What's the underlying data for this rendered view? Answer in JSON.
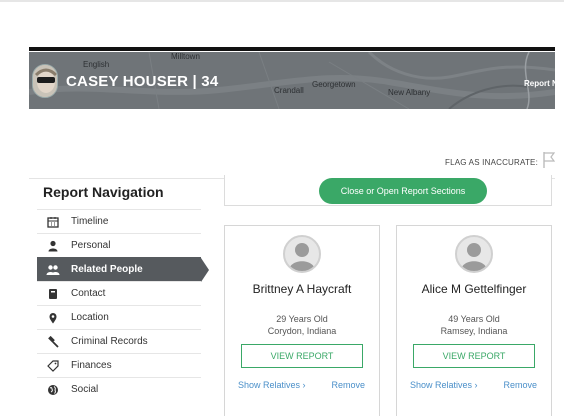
{
  "header": {
    "name": "CASEY HOUSER | 34",
    "report_nav_label": "Report N",
    "map_labels": [
      "Milltown",
      "English",
      "Crandall",
      "Georgetown",
      "New Albany"
    ]
  },
  "flag": {
    "label": "FLAG AS INACCURATE:"
  },
  "nav": {
    "title": "Report Navigation",
    "items": [
      {
        "label": "Timeline",
        "icon": "calendar-icon"
      },
      {
        "label": "Personal",
        "icon": "person-icon"
      },
      {
        "label": "Related People",
        "icon": "people-icon",
        "active": true
      },
      {
        "label": "Contact",
        "icon": "address-book-icon"
      },
      {
        "label": "Location",
        "icon": "map-pin-icon"
      },
      {
        "label": "Criminal Records",
        "icon": "gavel-icon"
      },
      {
        "label": "Finances",
        "icon": "tag-icon"
      },
      {
        "label": "Social",
        "icon": "globe-icon"
      }
    ]
  },
  "toggle_button": "Close or Open Report Sections",
  "people": [
    {
      "name": "Brittney A Haycraft",
      "age": "29 Years Old",
      "location": "Corydon, Indiana",
      "view_label": "VIEW REPORT",
      "relatives_label": "Show Relatives  ›",
      "remove_label": "Remove"
    },
    {
      "name": "Alice M Gettelfinger",
      "age": "49 Years Old",
      "location": "Ramsey, Indiana",
      "view_label": "VIEW REPORT",
      "relatives_label": "Show Relatives  ›",
      "remove_label": "Remove"
    }
  ],
  "colors": {
    "accent": "#3aa867",
    "link": "#4a8fc9",
    "nav_active": "#565a5e",
    "header_bg": "#6f7478"
  }
}
